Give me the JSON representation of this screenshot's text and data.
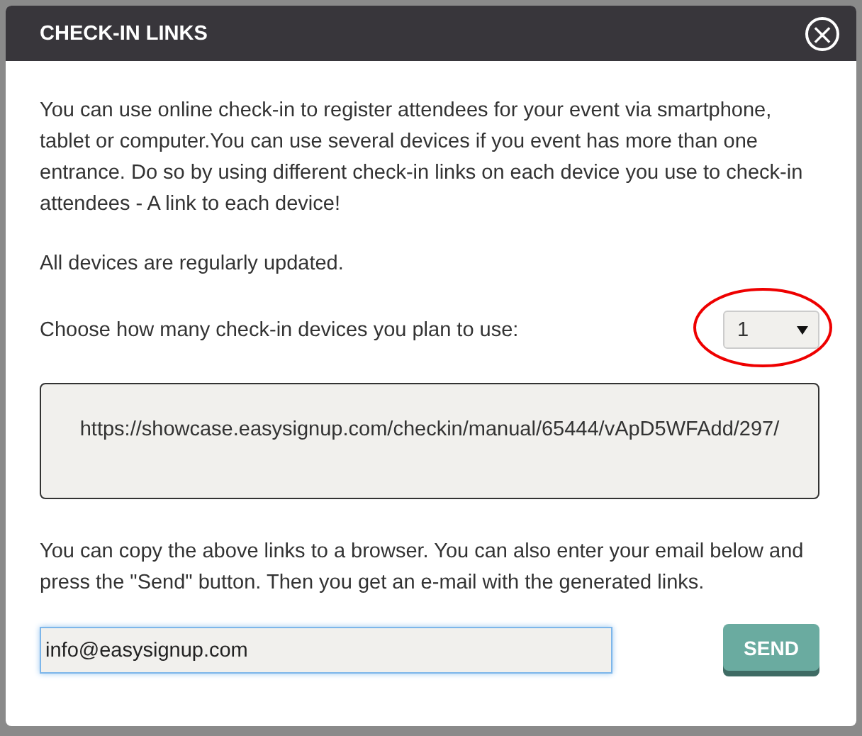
{
  "dialog": {
    "title": "CHECK-IN LINKS",
    "close_label": "×"
  },
  "intro": [
    "You can use online check-in to register attendees for your event via smartphone, tablet or computer.You can use several devices if you event has more than one entrance. Do so by using different check-in links on each device you use to check-in attendees - A link to each device!",
    "All devices are regularly updated."
  ],
  "device_count": {
    "label": "Choose how many check-in devices you plan to use:",
    "value": "1",
    "highlighted": true
  },
  "links": [
    "https://showcase.easysignup.com/checkin/manual/65444/vApD5WFAdd/297/"
  ],
  "instructions": "You can copy the above links to a browser. You can also enter your email below and press the \"Send\" button. Then you get an e-mail with the generated links.",
  "email": {
    "value": "info@easysignup.com",
    "focused": true
  },
  "buttons": [
    {
      "label": "SEND"
    }
  ]
}
